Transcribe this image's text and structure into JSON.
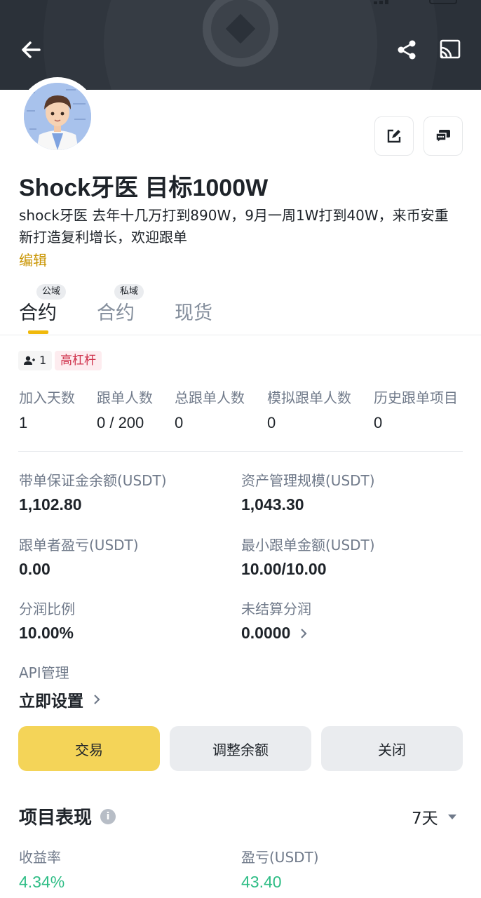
{
  "header": {
    "back_icon": "arrow-left-icon",
    "share_icon": "share-icon",
    "cast_icon": "cast-icon"
  },
  "profile": {
    "avatar_icon": "avatar-dentist-cartoon",
    "name": "Shock牙医 目标1000W",
    "bio": "shock牙医 去年十几万打到890W，9月一周1W打到40W，来币安重新打造复利增长，欢迎跟单",
    "edit_label": "编辑"
  },
  "tabs": [
    {
      "label": "合约",
      "badge": "公域",
      "active": true
    },
    {
      "label": "合约",
      "badge": "私域",
      "active": false
    },
    {
      "label": "现货",
      "badge": "",
      "active": false
    }
  ],
  "tags": {
    "follower_count": "1",
    "leverage": "高杠杆"
  },
  "stats": [
    {
      "label": "加入天数",
      "value": "1"
    },
    {
      "label": "跟单人数",
      "value": "0 / 200"
    },
    {
      "label": "总跟单人数",
      "value": "0"
    },
    {
      "label": "模拟跟单人数",
      "value": "0"
    },
    {
      "label": "历史跟单项目",
      "value": "0"
    }
  ],
  "metrics": {
    "margin_balance": {
      "label": "带单保证金余额(USDT)",
      "value": "1,102.80"
    },
    "aum": {
      "label": "资产管理规模(USDT)",
      "value": "1,043.30"
    },
    "follower_pnl": {
      "label": "跟单者盈亏(USDT)",
      "value": "0.00"
    },
    "min_copy": {
      "label": "最小跟单金额(USDT)",
      "value": "10.00/10.00"
    },
    "profit_share": {
      "label": "分润比例",
      "value": "10.00%"
    },
    "unsettled": {
      "label": "未结算分润",
      "value": "0.0000"
    },
    "api": {
      "label": "API管理",
      "value": "立即设置"
    }
  },
  "actions": {
    "trade": "交易",
    "adjust": "调整余额",
    "close": "关闭"
  },
  "performance": {
    "title": "项目表现",
    "period": "7天",
    "roi_label": "收益率",
    "roi_value": "4.34%",
    "pnl_label": "盈亏(USDT)",
    "pnl_value": "43.40"
  },
  "colors": {
    "brand": "#f0b90b",
    "trade_button": "#f4d458",
    "positive": "#2ebd85",
    "warning_tag": "#cf304a",
    "link": "#c99400"
  }
}
